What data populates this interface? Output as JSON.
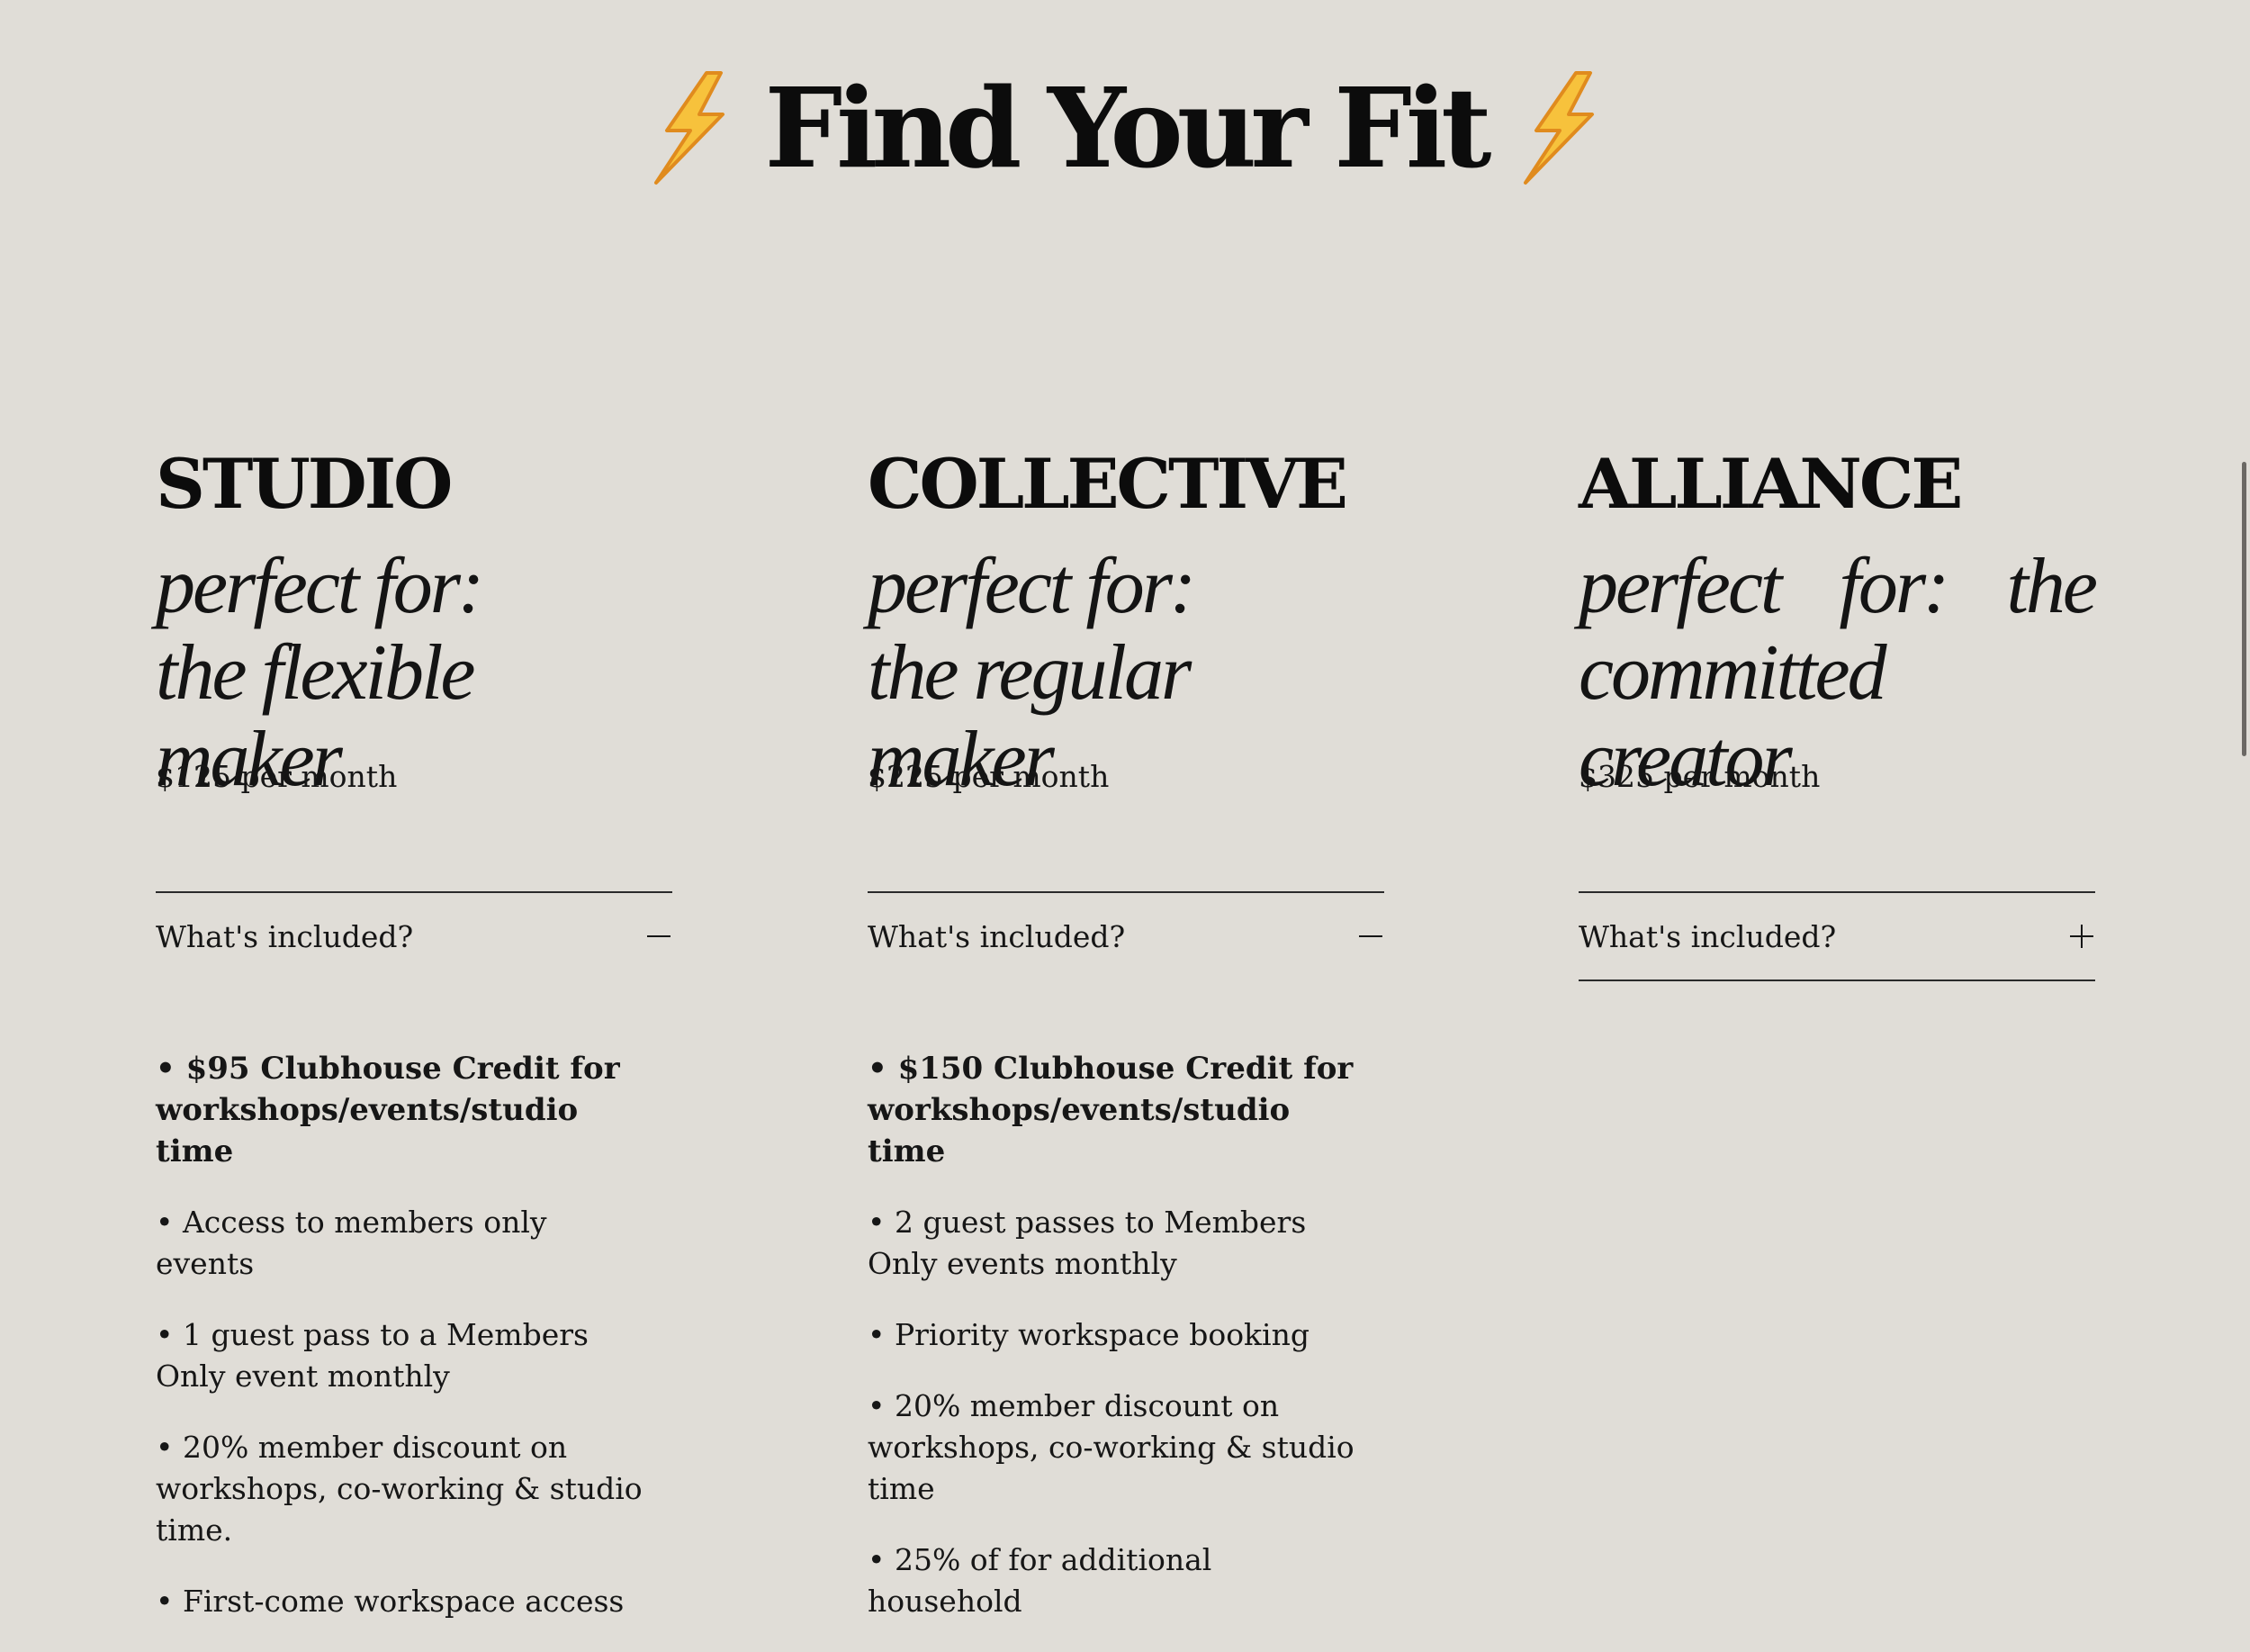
{
  "page": {
    "title": "Find Your Fit",
    "title_icon": "lightning-bolt-emoji",
    "accent_color": "#f5b42a",
    "background_color": "#e0ddd7"
  },
  "plans": [
    {
      "name": "STUDIO",
      "tagline_prefix": "perfect for:",
      "tagline_audience": "the flexible maker",
      "price": "$125 per month",
      "accordion_label": "What's included?",
      "expanded": true,
      "toggle_icon": "minus-icon",
      "features": [
        "• $95 Clubhouse Credit for workshops/events/studio time",
        "• Access to members only events",
        "• 1 guest pass to a Members Only event monthly",
        "• 20% member discount on workshops, co-working & studio time.",
        "• First-come workspace access"
      ]
    },
    {
      "name": "COLLECTIVE",
      "tagline_prefix": "perfect for:",
      "tagline_audience": "the regular maker",
      "price": "$225 per month",
      "accordion_label": "What's included?",
      "expanded": true,
      "toggle_icon": "minus-icon",
      "features": [
        "• $150 Clubhouse Credit for workshops/events/studio time",
        "• 2 guest passes to Members Only events monthly",
        "• Priority workspace booking",
        "• 20% member discount on workshops, co-working & studio time",
        "• 25% of for additional household"
      ]
    },
    {
      "name": "ALLIANCE",
      "tagline_prefix": "perfect for:",
      "tagline_audience": "the committed creator",
      "price": "$325 per month",
      "accordion_label": "What's included?",
      "expanded": false,
      "toggle_icon": "plus-icon",
      "features": []
    }
  ]
}
